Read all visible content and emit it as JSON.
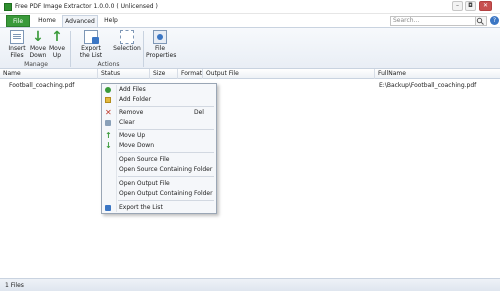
{
  "window": {
    "title": "Free PDF Image Extractor 1.0.0.0 ( Unlicensed )",
    "buttons": {
      "minimize": "–",
      "restore": "◘",
      "close": "✕"
    }
  },
  "tabs": [
    "File",
    "Home",
    "Advanced",
    "Help"
  ],
  "search": {
    "placeholder": "Search...",
    "icon": "search-icon"
  },
  "ribbon": {
    "insert_files": "Insert Files",
    "move_down": "Move Down",
    "move_up": "Move Up",
    "manage_label": "Manage",
    "export_list": "Export the List",
    "selection": "Selection",
    "actions_label": "Actions",
    "file_properties": "File Properties"
  },
  "grid": {
    "columns": [
      "Name",
      "Status",
      "Size",
      "Format",
      "Output File",
      "FullName"
    ],
    "rows": [
      {
        "name": "Football_coaching.pdf",
        "status": "",
        "size": "",
        "format": "",
        "output": "",
        "fullname": "E:\\Backup\\Football_coaching.pdf"
      }
    ]
  },
  "context_menu": {
    "items": [
      {
        "label": "Add Files",
        "icon": "add-icon"
      },
      {
        "label": "Add Folder",
        "icon": "folder-icon"
      },
      {
        "label": "Remove",
        "shortcut": "Del",
        "icon": "remove-icon"
      },
      {
        "label": "Clear",
        "icon": "clear-icon"
      },
      {
        "label": "Move Up",
        "icon": "arrow-up-icon"
      },
      {
        "label": "Move Down",
        "icon": "arrow-down-icon"
      },
      {
        "label": "Open Source File"
      },
      {
        "label": "Open Source Containing Folder"
      },
      {
        "label": "Open Output File"
      },
      {
        "label": "Open Output Containing Folder"
      },
      {
        "label": "Export the List",
        "icon": "export-icon"
      }
    ]
  },
  "status": {
    "text": "1 Files"
  },
  "colors": {
    "accent_green": "#3a9a3a",
    "ribbon_bg": "#e9eef5",
    "border": "#c9d3e0"
  }
}
